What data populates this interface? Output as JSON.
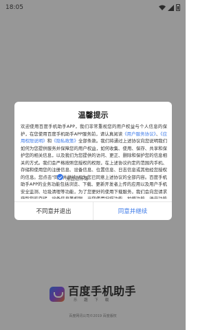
{
  "status_bar": {
    "time": "18:05"
  },
  "splash": {
    "brand_name": "百度手机助手",
    "brand_sub": "乐 趣 下 载",
    "copyright": "百度网讯公司©2019 百度版权"
  },
  "dialog": {
    "title": "温馨提示",
    "body_parts": [
      "欢迎使用百度手机助手APP，我们非常重视您的用户权益与个人信息的保护，在您使用百度手机助手APP服务前，请认真阅读",
      "《用户服务协议》",
      "、",
      "《应用权限说明》",
      "和",
      "《隐私政策》",
      "全部条款。我们将通过上述协议向您说明我们如何为您提供服务并保障您的用户权益，如何收集、使用、保存、共享和保护您的相关信息，以及我们为您提供的访问、更正、删除和保护您的信息相关的方式。我们会严格按照您授权的权限，在上述协议约定的范围内手机、存储和使用您的注册信息、设备信息、位置信息、日志信息或其他经您授权的信息。您点击\"同意并继续\"视为您已同意上述协议的全部内容。百度手机助手APP的业务功能包括浏览、下载、更新开发者上传的应用以及用户手机安全监测、垃圾清理等功能，为了您更好的使用下载服务，我们会向您请求获取您的存储、设备信息等权限。当您使用扫描功能、拍摄功能、语音功能时，我们会申请获取您的摄像头、麦克风权限。"
    ],
    "float_ball_label": "桌面悬浮球",
    "float_ball_checked": true,
    "disagree_label": "不同意并退出",
    "agree_label": "同意并继续"
  },
  "colors": {
    "accent": "#3a78e8",
    "overlay": "rgba(0,0,0,0.38)"
  }
}
